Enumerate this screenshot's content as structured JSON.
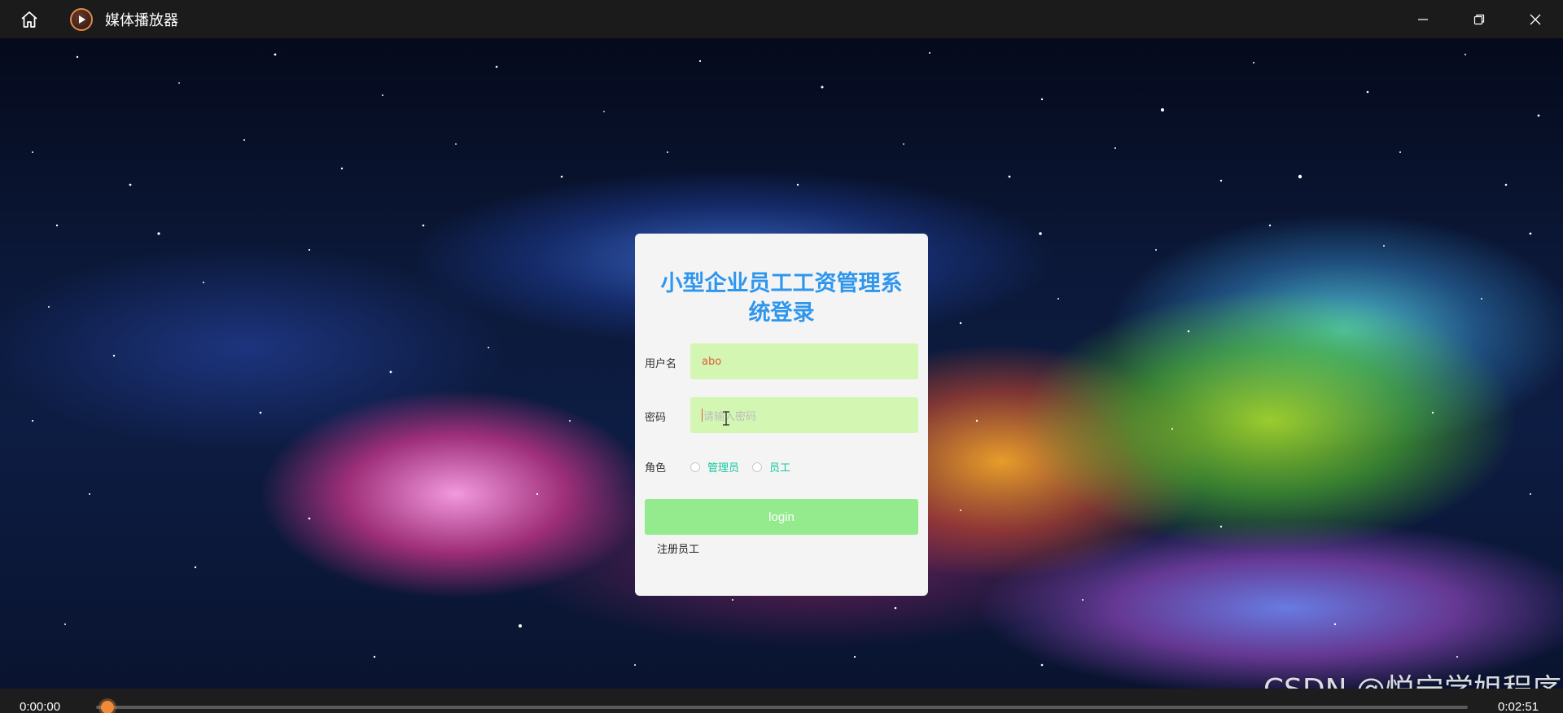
{
  "titlebar": {
    "app_title": "媒体播放器",
    "icons": [
      "home-icon",
      "play-circle-icon",
      "minimize-icon",
      "restore-icon",
      "close-icon"
    ]
  },
  "login": {
    "title": "小型企业员工工资管理系统登录",
    "username_label": "用户名",
    "username_value": "abo",
    "password_label": "密码",
    "password_placeholder": "请输入密码",
    "role_label": "角色",
    "role_options": [
      "管理员",
      "员工"
    ],
    "login_button": "login",
    "register_link": "注册员工"
  },
  "player": {
    "current_time": "0:00:00",
    "total_time": "0:02:51",
    "progress": 0.0
  },
  "watermark": "CSDN @悦宁学姐程序",
  "colors": {
    "title_blue": "#2f96ee",
    "field_green": "#d3f7b3",
    "button_green": "#93eb8d",
    "radio_label": "#17c7a0",
    "accent_orange": "#ef8a3a"
  }
}
